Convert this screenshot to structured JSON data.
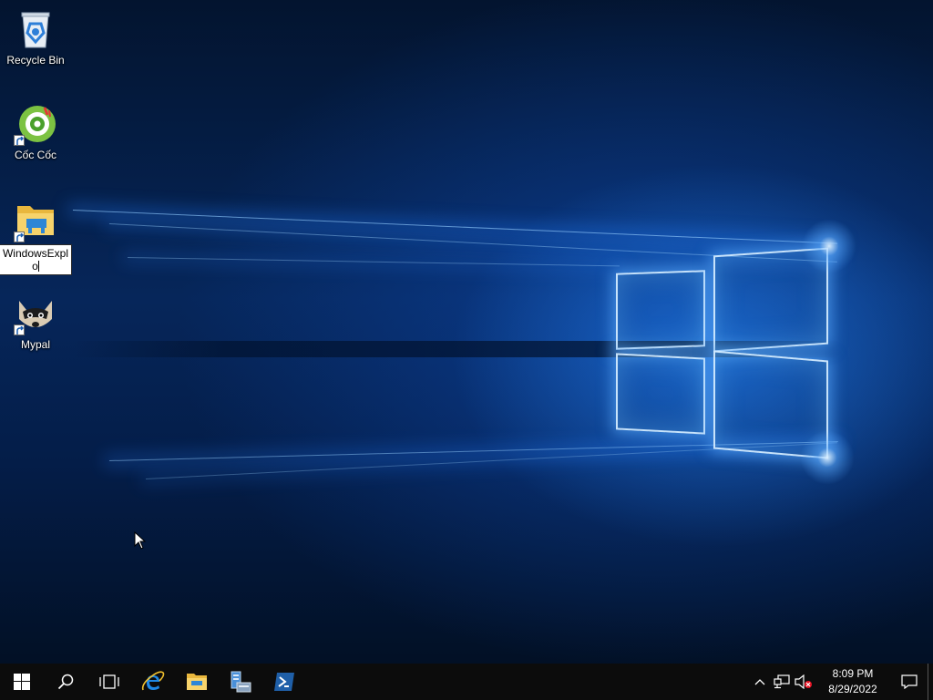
{
  "desktop": {
    "icons": [
      {
        "label": "Recycle Bin",
        "icon": "recycle-bin-icon"
      },
      {
        "label": "Cốc Cốc",
        "icon": "coc-coc-browser-icon",
        "shortcut": true
      },
      {
        "label": "WindowsExplo",
        "icon": "folder-icon",
        "shortcut": true,
        "renaming": true
      },
      {
        "label": "Mypal",
        "icon": "mypal-raccoon-icon",
        "shortcut": true
      }
    ]
  },
  "taskbar": {
    "pinned": [
      {
        "name": "start-button",
        "icon": "windows-logo-icon"
      },
      {
        "name": "search-button",
        "icon": "search-icon"
      },
      {
        "name": "task-view-button",
        "icon": "task-view-icon"
      },
      {
        "name": "internet-explorer-button",
        "icon": "internet-explorer-icon"
      },
      {
        "name": "file-explorer-button",
        "icon": "file-explorer-icon"
      },
      {
        "name": "server-manager-button",
        "icon": "server-manager-icon"
      },
      {
        "name": "powershell-button",
        "icon": "powershell-icon"
      }
    ],
    "tray": {
      "time": "8:09 PM",
      "date": "8/29/2022"
    }
  },
  "colors": {
    "taskbar": "#0c0c0c",
    "accent": "#2b8fff",
    "ie_blue": "#1e88e5",
    "folder_yellow": "#f3c544",
    "powershell": "#1f5fa8"
  }
}
